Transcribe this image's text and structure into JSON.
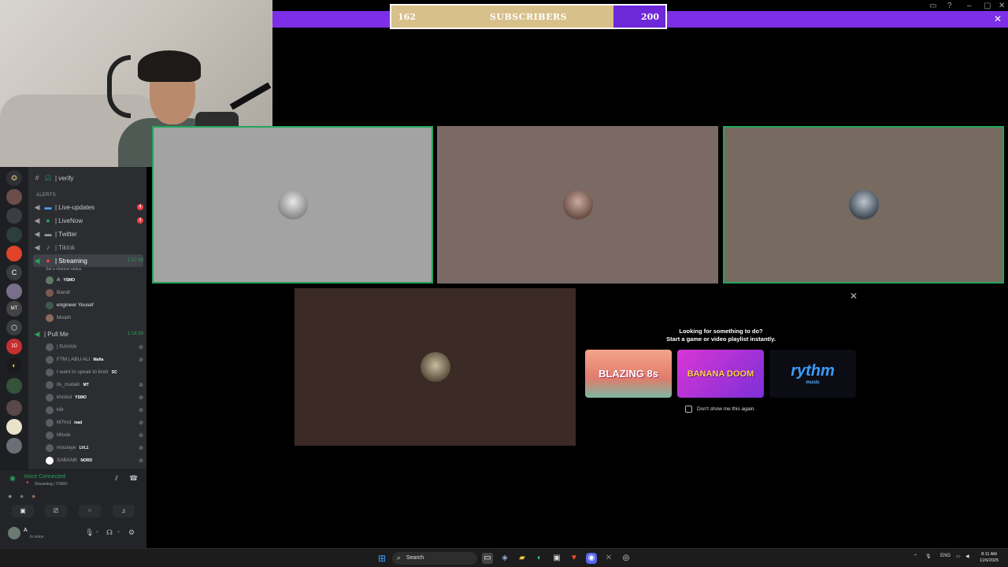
{
  "subscriber_goal": {
    "current": "162",
    "label": "SUBSCRIBERS",
    "goal": "200",
    "progress": 0.81
  },
  "channels": {
    "verify": "| verify",
    "category": "ALERTS",
    "live_updates": "| Live-updates",
    "live_now": "| LiveNow",
    "twitter": "| Twitter",
    "tiktok": "| Tiktok",
    "streaming": "| Streaming",
    "streaming_timer": "1:17:00",
    "streaming_status": "Set a channel status",
    "pull_me": "| Pull Me",
    "pull_me_timer": "1:16:39"
  },
  "streaming_users": [
    {
      "name": "A",
      "tag": "YSMO",
      "bright": true
    },
    {
      "name": "Bandr",
      "tag": "",
      "bright": false
    },
    {
      "name": "engineer Yousef",
      "tag": "",
      "bright": true
    },
    {
      "name": "Moath",
      "tag": "",
      "bright": false
    }
  ],
  "pull_me_users": [
    {
      "name": "| RAYAN",
      "tag": ""
    },
    {
      "name": "F7M | ABU ALI",
      "tag": "Mafia"
    },
    {
      "name": "I want to speak to bndr",
      "tag": "SC"
    },
    {
      "name": "its_mutairi",
      "tag": "MT"
    },
    {
      "name": "kholod",
      "tag": "YSMO"
    },
    {
      "name": "k8r",
      "tag": ""
    },
    {
      "name": "M7md",
      "tag": "mad"
    },
    {
      "name": "Mlook",
      "tag": ""
    },
    {
      "name": "moulaye",
      "tag": "LVL1"
    },
    {
      "name": "SABANK",
      "tag": "NORD"
    }
  ],
  "voice": {
    "connected": "Voice Connected",
    "location": "Streaming / YSMO",
    "username": "A",
    "user_status": "In voice"
  },
  "activity": {
    "title": "Looking for something to do?",
    "subtitle": "Start a game or video playlist instantly.",
    "games": [
      {
        "name": "BLAZING 8s"
      },
      {
        "name": "BANANA DOOM"
      },
      {
        "name": "rythm",
        "sub": "music"
      }
    ],
    "checkbox_label": "Don't show me this again."
  },
  "taskbar": {
    "search": "Search",
    "lang": "ENG",
    "time": "8:11 AM",
    "date": "11/6/2025"
  },
  "rail_labels": [
    "C",
    "MT",
    "10"
  ],
  "colors": {
    "accent_purple": "#7c2fe6",
    "goal_fill": "#d8c08a",
    "speaking_green": "#23a55a",
    "badge_red": "#f23f43"
  }
}
